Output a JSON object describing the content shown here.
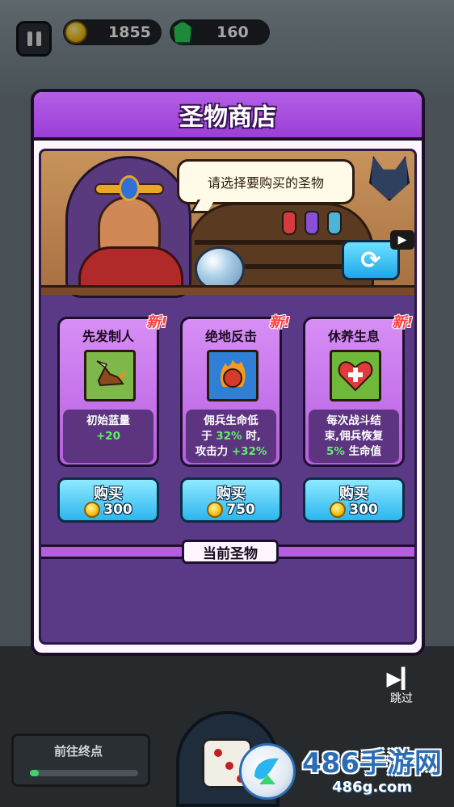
{
  "hud": {
    "coins": "1855",
    "gems": "160"
  },
  "shop": {
    "title": "圣物商店",
    "prompt": "请选择要购买的圣物",
    "current_relics_label": "当前圣物",
    "new_tag": "新!",
    "buy_label": "购买",
    "items": [
      {
        "name": "先发制人",
        "icon": "winged-boot-icon",
        "desc_line1": "初始蓝量",
        "desc_value": "+20",
        "price": "300"
      },
      {
        "name": "绝地反击",
        "icon": "flaming-fist-icon",
        "desc_line1": "佣兵生命低",
        "desc_line2_prefix": "于",
        "desc_line2_value": "32%",
        "desc_line2_suffix": "时,",
        "desc_line3_prefix": "攻击力",
        "desc_line3_value": "+32%",
        "price": "750"
      },
      {
        "name": "休养生息",
        "icon": "heart-medkit-icon",
        "desc_line1": "每次战斗结",
        "desc_line2": "束,佣兵恢复",
        "desc_line3_value": "5%",
        "desc_line3_suffix": "生命值",
        "price": "300"
      }
    ]
  },
  "bottom": {
    "skip_label": "跳过",
    "goal_label": "前往终点"
  },
  "watermark": {
    "title": "486手游网",
    "url": "486g.com"
  },
  "colors": {
    "header_purple": "#9b3fd6",
    "card_purple": "#c773ea",
    "buy_blue": "#2bb5ef",
    "highlight_green": "#62f06a",
    "new_red": "#ff3b3b"
  }
}
